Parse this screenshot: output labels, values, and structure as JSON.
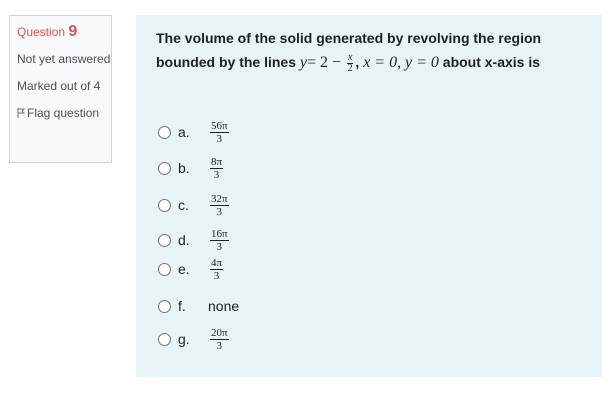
{
  "info": {
    "question_label": "Question",
    "question_number": "9",
    "state": "Not yet answered",
    "grade": "Marked out of 4",
    "flag_label": "Flag question"
  },
  "question": {
    "text_part1": "The volume of the solid generated by revolving the region bounded by the lines",
    "eq1_var": "y",
    "eq1_rhs": "= 2 −",
    "eq1_frac_num": "x",
    "eq1_frac_den": "2",
    "eq2": "x = 0,",
    "eq3": "y = 0",
    "text_part2": "about x-axis is"
  },
  "options": [
    {
      "letter": "a.",
      "numerator": "56π",
      "denominator": "3"
    },
    {
      "letter": "b.",
      "numerator": "8π",
      "denominator": "3"
    },
    {
      "letter": "c.",
      "numerator": "32π",
      "denominator": "3"
    },
    {
      "letter": "d.",
      "numerator": "16π",
      "denominator": "3"
    },
    {
      "letter": "e.",
      "numerator": "4π",
      "denominator": "3"
    },
    {
      "letter": "f.",
      "text": "none"
    },
    {
      "letter": "g.",
      "numerator": "20π",
      "denominator": "3"
    }
  ]
}
